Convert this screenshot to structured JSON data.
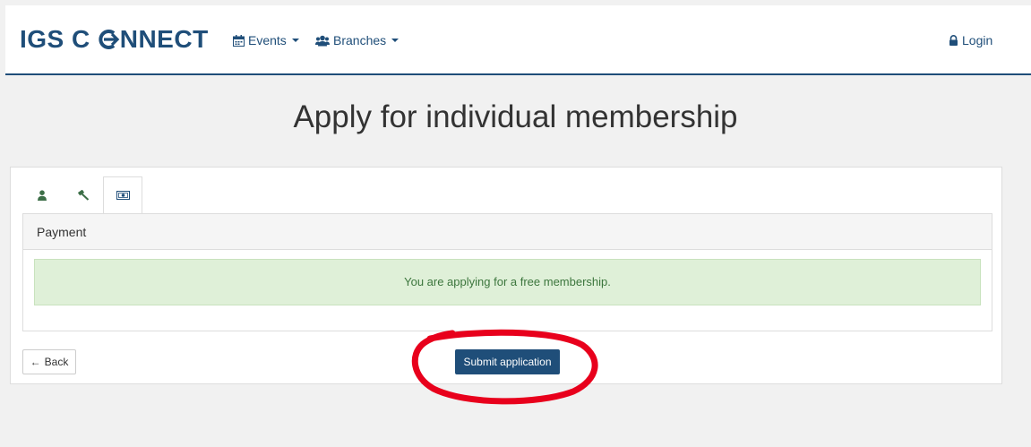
{
  "navbar": {
    "brand_part1": "IGS C",
    "brand_part2": "NNECT",
    "events_label": "Events",
    "branches_label": "Branches",
    "login_label": "Login"
  },
  "page": {
    "title": "Apply for individual membership"
  },
  "tabs": [
    {
      "icon": "user-icon",
      "active": false
    },
    {
      "icon": "gavel-icon",
      "active": false
    },
    {
      "icon": "money-icon",
      "active": true
    }
  ],
  "payment": {
    "heading": "Payment",
    "message": "You are applying for a free membership."
  },
  "actions": {
    "back_label": "Back",
    "submit_label": "Submit application"
  },
  "colors": {
    "brand": "#1f4e79",
    "success_bg": "#dff0d8",
    "success_text": "#3c763d",
    "annotation_red": "#e8001c"
  }
}
